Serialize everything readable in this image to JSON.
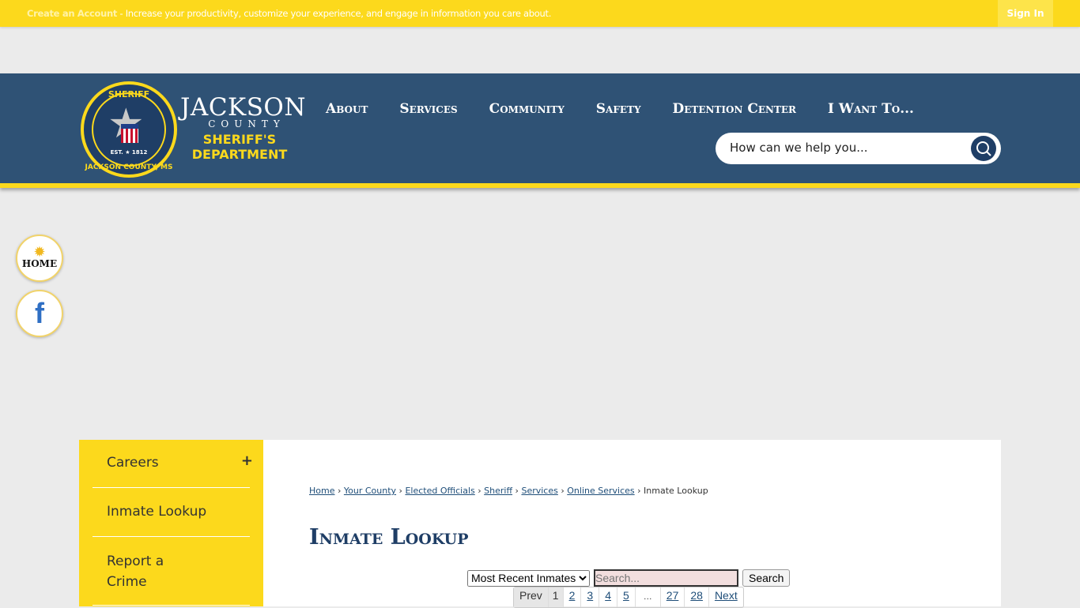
{
  "topbar": {
    "create_link": "Create an Account",
    "message": " - Increase your productivity, customize your experience, and engage in information you care about.",
    "sign_in": "Sign In"
  },
  "logo": {
    "seal_top": "SHERIFF",
    "seal_est": "EST. ★ 1812",
    "seal_bottom": "JACKSON COUNTY, MS",
    "name": "JACKSON",
    "county": "COUNTY",
    "dept1": "SHERIFF'S",
    "dept2": "DEPARTMENT"
  },
  "nav": [
    "About",
    "Services",
    "Community",
    "Safety",
    "Detention Center",
    "I Want To..."
  ],
  "search": {
    "placeholder": "How can we help you..."
  },
  "social": {
    "home": "HOME",
    "facebook": "f"
  },
  "sidebar": {
    "items": [
      {
        "label": "Careers"
      },
      {
        "label": "Inmate Lookup"
      },
      {
        "label": "Report a Crime"
      }
    ],
    "expand": "+"
  },
  "breadcrumb": [
    "Home",
    "Your County",
    "Elected Officials",
    "Sheriff",
    "Services",
    "Online Services"
  ],
  "breadcrumb_current": "Inmate Lookup",
  "page_title": "Inmate Lookup",
  "lookup": {
    "select_value": "Most Recent Inmates",
    "search_placeholder": "Search...",
    "search_button": "Search"
  },
  "pager": {
    "prev": "Prev",
    "pages": [
      "1",
      "2",
      "3",
      "4",
      "5",
      "…",
      "27",
      "28"
    ],
    "next": "Next",
    "current": "1"
  },
  "colors": {
    "yellow": "#fcd91c",
    "navy": "#2f5275"
  }
}
